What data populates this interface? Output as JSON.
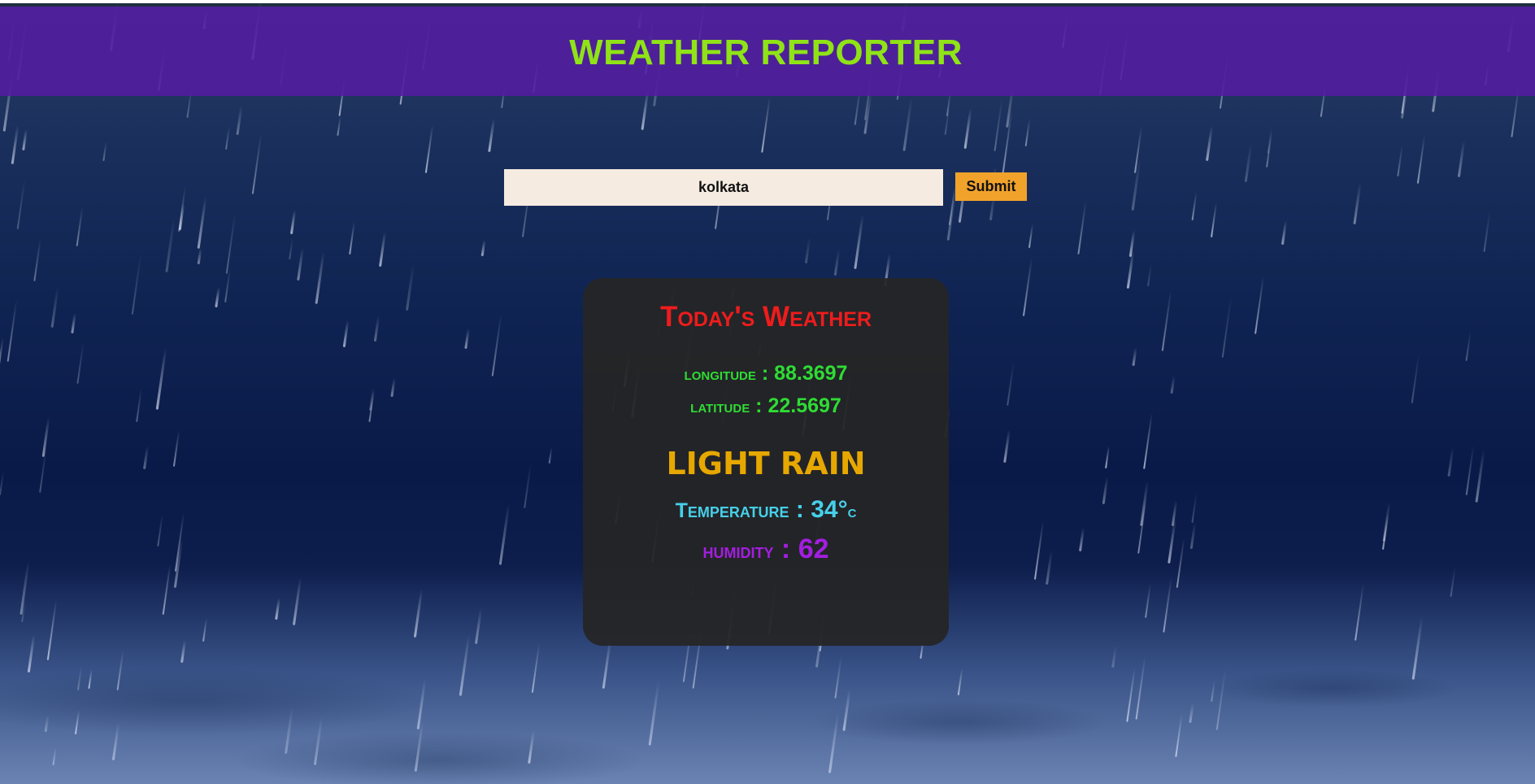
{
  "header": {
    "title": "WEATHER REPORTER"
  },
  "search": {
    "value": "kolkata",
    "button_label": "Submit"
  },
  "card": {
    "title": "Today's Weather",
    "longitude_label": "longitude",
    "longitude_value": "88.3697",
    "latitude_label": "latitude",
    "latitude_value": "22.5697",
    "condition": "LIGHT RAIN",
    "temperature_label": "Temperature",
    "temperature_value": "34°",
    "temperature_unit": "c",
    "humidity_label": "humidity",
    "humidity_value": "62"
  },
  "colors": {
    "header_bg": "#531da0",
    "title": "#8fe316",
    "card_title": "#ee1c1c",
    "coords": "#2fdc34",
    "condition": "#e6a800",
    "temperature": "#46d0ea",
    "humidity": "#a31ee0",
    "submit_bg": "#f0a22b",
    "input_bg": "#f5ebe0"
  }
}
